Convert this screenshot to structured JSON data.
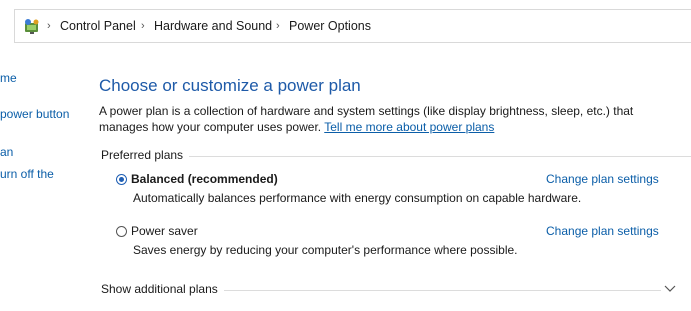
{
  "breadcrumb": {
    "icon": "control-panel-icon",
    "items": [
      "Control Panel",
      "Hardware and Sound",
      "Power Options"
    ]
  },
  "sidebar": {
    "items": [
      "me",
      "power button",
      "an",
      "urn off the"
    ]
  },
  "main": {
    "title": "Choose or customize a power plan",
    "description": "A power plan is a collection of hardware and system settings (like display brightness, sleep, etc.) that manages how your computer uses power.",
    "learn_more_link": "Tell me more about power plans",
    "preferred_plans_label": "Preferred plans",
    "plans": [
      {
        "name": "Balanced (recommended)",
        "description": "Automatically balances performance with energy consumption on capable hardware.",
        "change_link": "Change plan settings",
        "selected": true
      },
      {
        "name": "Power saver",
        "description": "Saves energy by reducing your computer's performance where possible.",
        "change_link": "Change plan settings",
        "selected": false
      }
    ],
    "show_additional_label": "Show additional plans"
  },
  "colors": {
    "title": "#1e5aa8",
    "link": "#0b5ea8",
    "radio_selected": "#1f5fb4"
  }
}
